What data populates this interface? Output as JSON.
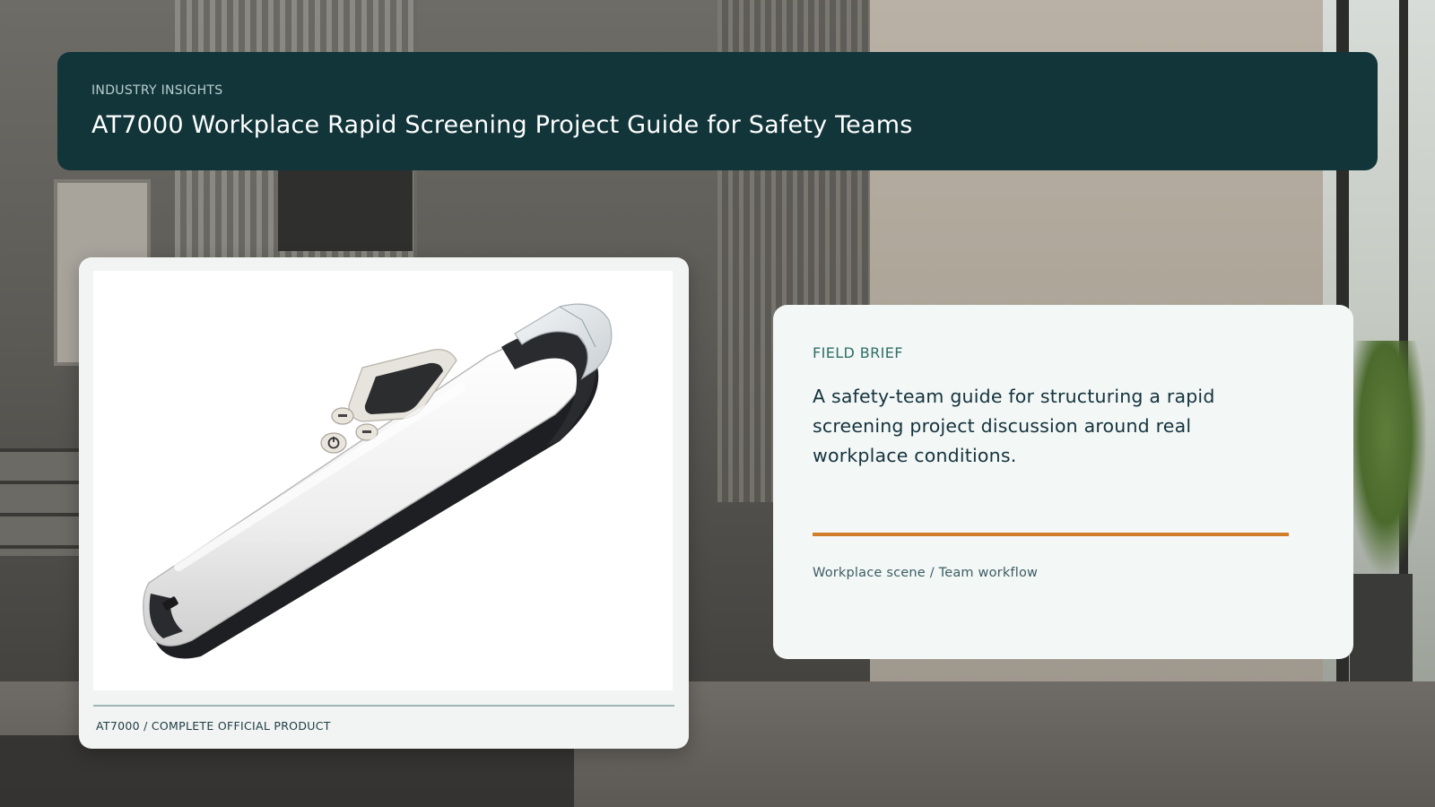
{
  "header": {
    "eyebrow": "INDUSTRY INSIGHTS",
    "title": "AT7000 Workplace Rapid Screening Project Guide for Safety Teams"
  },
  "product": {
    "caption": "AT7000 / COMPLETE OFFICIAL PRODUCT"
  },
  "brief": {
    "eyebrow": "FIELD BRIEF",
    "body": "A safety-team guide for structuring a rapid screening project discussion around real workplace conditions.",
    "meta": "Workplace scene / Team workflow"
  },
  "colors": {
    "header_bg": "#12353a",
    "accent": "#d27d2a",
    "card_bg": "#f3f7f6"
  }
}
